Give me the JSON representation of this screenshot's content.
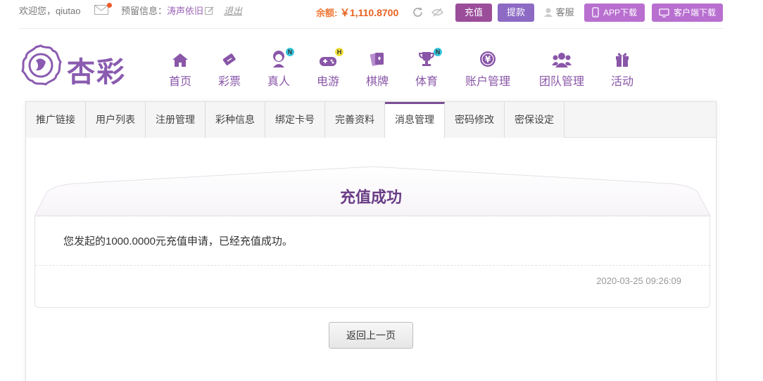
{
  "topbar": {
    "welcome": "欢迎您，qiutao",
    "reserve_label": "预留信息：",
    "reserve_value": "涛声依旧",
    "logout": "退出",
    "balance_label": "余额: ",
    "balance_value": "￥1,110.8700",
    "recharge": "充值",
    "withdraw": "提款",
    "service": "客服",
    "app_download": "APP下载",
    "client_download": "客户端下载"
  },
  "logo": {
    "text": "杏彩"
  },
  "nav": [
    {
      "label": "首页",
      "icon": "home-icon"
    },
    {
      "label": "彩票",
      "icon": "ticket-icon"
    },
    {
      "label": "真人",
      "icon": "dealer-icon",
      "badge": "N"
    },
    {
      "label": "电游",
      "icon": "gamepad-icon",
      "badge": "H"
    },
    {
      "label": "棋牌",
      "icon": "cards-icon"
    },
    {
      "label": "体育",
      "icon": "trophy-icon",
      "badge": "N"
    },
    {
      "label": "账户管理",
      "icon": "yen-icon"
    },
    {
      "label": "团队管理",
      "icon": "team-icon"
    },
    {
      "label": "活动",
      "icon": "gift-icon"
    }
  ],
  "tabs": [
    "推广链接",
    "用户列表",
    "注册管理",
    "彩种信息",
    "绑定卡号",
    "完善资料",
    "消息管理",
    "密码修改",
    "密保设定"
  ],
  "active_tab": 6,
  "message": {
    "title": "充值成功",
    "body": "您发起的1000.0000元充值申请，已经充值成功。",
    "time": "2020-03-25 09:26:09"
  },
  "back_button": "返回上一页",
  "colors": {
    "accent": "#8a56a8",
    "balance": "#e9611e",
    "recharge": "#9b4d9a",
    "withdraw": "#8d6ac4",
    "download": "#b86fd0"
  }
}
